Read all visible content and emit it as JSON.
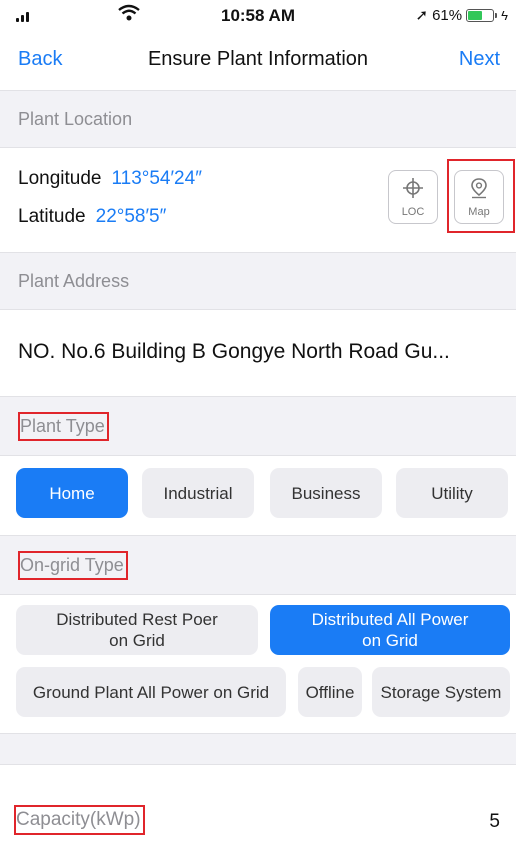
{
  "status_bar": {
    "time": "10:58 AM",
    "battery_percent": "61%",
    "battery_fraction": 0.61,
    "wifi_icon": "wifi-icon",
    "signal_icon": "signal-bars-icon",
    "location_icon": "location-arrow-icon",
    "charging_icon": "charging-bolt-icon"
  },
  "nav": {
    "back_label": "Back",
    "title": "Ensure Plant Information",
    "next_label": "Next",
    "accent_color": "#1a7cf5"
  },
  "location": {
    "header": "Plant Location",
    "longitude_label": "Longitude",
    "longitude_value": "113°54′24″",
    "latitude_label": "Latitude",
    "latitude_value": "22°58′5″",
    "loc_button": {
      "label": "LOC",
      "icon": "crosshair-icon"
    },
    "map_button": {
      "label": "Map",
      "icon": "map-pin-icon"
    }
  },
  "address": {
    "header": "Plant Address",
    "value": "NO. No.6 Building B Gongye North Road Gu..."
  },
  "plant_type": {
    "header": "Plant Type",
    "options": [
      "Home",
      "Industrial",
      "Business",
      "Utility"
    ],
    "selected": "Home"
  },
  "ongrid_type": {
    "header": "On-grid Type",
    "options": [
      "Distributed Rest Poer on Grid",
      "Distributed All Power on Grid",
      "Ground Plant All Power on Grid",
      "Offline",
      "Storage System"
    ],
    "selected": "Distributed All Power on Grid"
  },
  "capacity": {
    "label": "Capacity(kWp)",
    "value": "5"
  },
  "colors": {
    "highlight_box": "#e0252b",
    "selected_chip": "#1a7cf5",
    "unselected_chip": "#ededf1",
    "section_bg": "#f2f2f6"
  }
}
